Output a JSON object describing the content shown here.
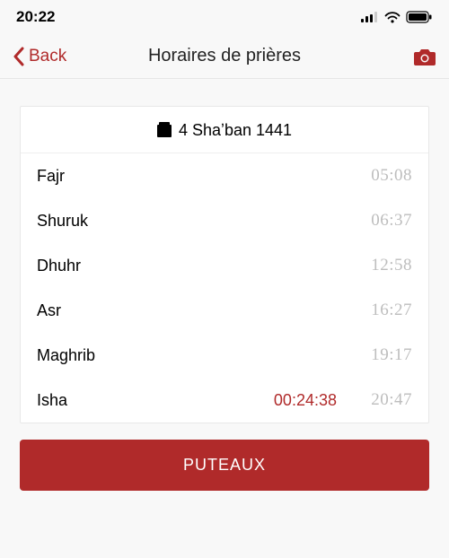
{
  "statusbar": {
    "time": "20:22"
  },
  "navbar": {
    "back_label": "Back",
    "title": "Horaires de prières"
  },
  "card": {
    "date": "4 Shaʼban 1441",
    "rows": [
      {
        "name": "Fajr",
        "time": "05:08",
        "countdown": ""
      },
      {
        "name": "Shuruk",
        "time": "06:37",
        "countdown": ""
      },
      {
        "name": "Dhuhr",
        "time": "12:58",
        "countdown": ""
      },
      {
        "name": "Asr",
        "time": "16:27",
        "countdown": ""
      },
      {
        "name": "Maghrib",
        "time": "19:17",
        "countdown": ""
      },
      {
        "name": "Isha",
        "time": "20:47",
        "countdown": "00:24:38"
      }
    ]
  },
  "location_button": "PUTEAUX",
  "colors": {
    "accent": "#b02a2a"
  }
}
